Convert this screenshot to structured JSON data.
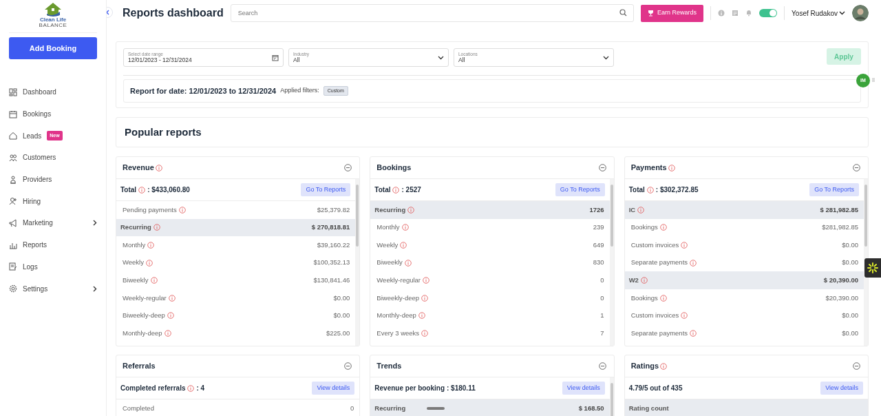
{
  "logo": {
    "name": "Clean Life",
    "tagline": "BALANCE"
  },
  "add_button": "Add Booking",
  "nav": [
    {
      "label": "Dashboard",
      "expandable": false
    },
    {
      "label": "Bookings",
      "expandable": false
    },
    {
      "label": "Leads",
      "badge": "New",
      "expandable": false
    },
    {
      "label": "Customers",
      "expandable": false
    },
    {
      "label": "Providers",
      "expandable": false
    },
    {
      "label": "Hiring",
      "expandable": false
    },
    {
      "label": "Marketing",
      "expandable": true
    },
    {
      "label": "Reports",
      "expandable": false
    },
    {
      "label": "Logs",
      "expandable": false
    },
    {
      "label": "Settings",
      "expandable": true
    }
  ],
  "header": {
    "title": "Reports dashboard",
    "search_placeholder": "Search",
    "rewards_button": "Earn Rewards",
    "toggle_on": true,
    "user_name": "Yosef Rudakov"
  },
  "filters": {
    "fields": [
      {
        "kind": "date",
        "label": "Select date range",
        "value": "12/01/2023 - 12/31/2024"
      },
      {
        "kind": "select",
        "label": "Industry",
        "value": "All"
      },
      {
        "kind": "select",
        "label": "Locations",
        "value": "All"
      }
    ],
    "apply_button": {
      "label": "Apply",
      "disabled": true
    },
    "report_for": "Report for date: 12/01/2023 to 12/31/2024",
    "applied_label": "Applied filters:",
    "tags": [
      "Custom"
    ]
  },
  "section_title": "Popular reports",
  "cards": [
    {
      "title": "Revenue",
      "info": true,
      "total_label": "Total",
      "total_info": true,
      "total_value": ": $433,060.80",
      "button": "Go To Reports",
      "scrollable": true,
      "rows": [
        {
          "kind": "item",
          "label": "Pending payments",
          "info": true,
          "value": "$25,379.82"
        },
        {
          "kind": "group",
          "label": "Recurring",
          "info": true,
          "value": "$ 270,818.81"
        },
        {
          "kind": "item",
          "label": "Monthly",
          "info": true,
          "value": "$39,160.22"
        },
        {
          "kind": "item",
          "label": "Weekly",
          "info": true,
          "value": "$100,352.13"
        },
        {
          "kind": "item",
          "label": "Biweekly",
          "info": true,
          "value": "$130,841.46"
        },
        {
          "kind": "item",
          "label": "Weekly-regular",
          "info": true,
          "value": "$0.00"
        },
        {
          "kind": "item",
          "label": "Biweekly-deep",
          "info": true,
          "value": "$0.00"
        },
        {
          "kind": "item",
          "label": "Monthly-deep",
          "info": true,
          "value": "$225.00"
        }
      ]
    },
    {
      "title": "Bookings",
      "info": false,
      "total_label": "Total",
      "total_info": true,
      "total_value": ": 2527",
      "button": "Go To Reports",
      "scrollable": true,
      "rows": [
        {
          "kind": "group",
          "label": "Recurring",
          "info": true,
          "value": "1726"
        },
        {
          "kind": "item",
          "label": "Monthly",
          "info": true,
          "value": "239"
        },
        {
          "kind": "item",
          "label": "Weekly",
          "info": true,
          "value": "649"
        },
        {
          "kind": "item",
          "label": "Biweekly",
          "info": true,
          "value": "830"
        },
        {
          "kind": "item",
          "label": "Weekly-regular",
          "info": true,
          "value": "0"
        },
        {
          "kind": "item",
          "label": "Biweekly-deep",
          "info": true,
          "value": "0"
        },
        {
          "kind": "item",
          "label": "Monthly-deep",
          "info": true,
          "value": "1"
        },
        {
          "kind": "item",
          "label": "Every 3 weeks",
          "info": true,
          "value": "7"
        }
      ]
    },
    {
      "title": "Payments",
      "info": true,
      "total_label": "Total",
      "total_info": true,
      "total_value": ": $302,372.85",
      "button": "Go To Reports",
      "scrollable": true,
      "rows": [
        {
          "kind": "group",
          "label": "IC",
          "info": true,
          "value": "$ 281,982.85"
        },
        {
          "kind": "item",
          "label": "Bookings",
          "info": true,
          "value": "$281,982.85"
        },
        {
          "kind": "item",
          "label": "Custom invoices",
          "info": true,
          "value": "$0.00"
        },
        {
          "kind": "item",
          "label": "Separate payments",
          "info": true,
          "value": "$0.00"
        },
        {
          "kind": "group",
          "label": "W2",
          "info": true,
          "value": "$ 20,390.00"
        },
        {
          "kind": "item",
          "label": "Bookings",
          "info": true,
          "value": "$20,390.00"
        },
        {
          "kind": "item",
          "label": "Custom invoices",
          "info": true,
          "value": "$0.00"
        },
        {
          "kind": "item",
          "label": "Separate payments",
          "info": true,
          "value": "$0.00"
        }
      ]
    },
    {
      "title": "Referrals",
      "info": false,
      "total_label": "Completed referrals",
      "total_info": true,
      "total_value": ": 4",
      "button": "View details",
      "scrollable": false,
      "rows": [
        {
          "kind": "item",
          "label": "Completed",
          "info": false,
          "value": "0"
        }
      ]
    },
    {
      "title": "Trends",
      "info": false,
      "total_label": "Revenue per booking",
      "total_info": false,
      "total_value": ": $180.11",
      "button": "View details",
      "scrollable": true,
      "rows": [
        {
          "kind": "group",
          "label": "Recurring",
          "info": false,
          "bar": true,
          "value": "$ 168.50"
        }
      ]
    },
    {
      "title": "Ratings",
      "info": true,
      "total_label": "4.79/5 out of 435",
      "total_info": false,
      "button": "View details",
      "scrollable": false,
      "rows": [
        {
          "kind": "group",
          "label": "Rating count",
          "info": false
        }
      ]
    }
  ],
  "widget_badge": "IM"
}
